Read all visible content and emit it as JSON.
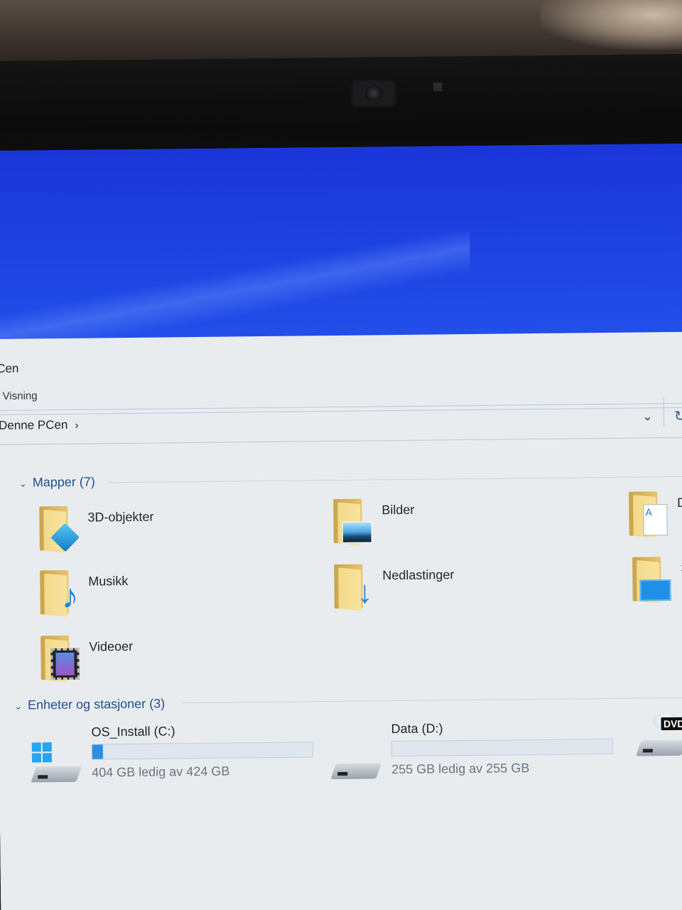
{
  "window": {
    "title": "Cen",
    "ribbon_tab": "Visning",
    "address": "Denne PCen",
    "address_chevron": "›",
    "dropdown_icon": "chevron-down-icon",
    "refresh_icon": "refresh-icon"
  },
  "folders_group": {
    "header": "Mapper (7)",
    "items": [
      {
        "label": "3D-objekter",
        "icon": "3d-objects-folder-icon"
      },
      {
        "label": "Bilder",
        "icon": "pictures-folder-icon"
      },
      {
        "label": "D",
        "icon": "documents-folder-icon"
      },
      {
        "label": "Musikk",
        "icon": "music-folder-icon"
      },
      {
        "label": "Nedlastinger",
        "icon": "downloads-folder-icon"
      },
      {
        "label": "S",
        "icon": "desktop-folder-icon"
      },
      {
        "label": "Videoer",
        "icon": "videos-folder-icon"
      }
    ]
  },
  "drives_group": {
    "header": "Enheter og stasjoner (3)",
    "items": [
      {
        "name": "OS_Install (C:)",
        "free": "404 GB ledig av 424 GB",
        "used_fraction": 0.047,
        "icon": "windows-drive-icon"
      },
      {
        "name": "Data (D:)",
        "free": "255 GB ledig av 255 GB",
        "used_fraction": 0.0,
        "icon": "hard-drive-icon"
      },
      {
        "name": "",
        "badge": "DVD",
        "icon": "dvd-drive-icon"
      }
    ]
  }
}
